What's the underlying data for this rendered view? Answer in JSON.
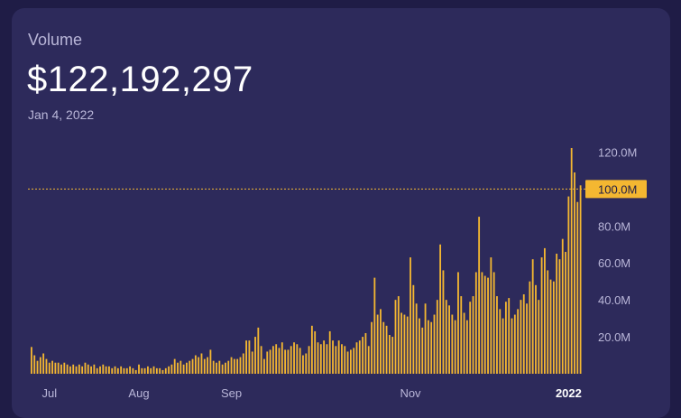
{
  "header": {
    "title": "Volume",
    "value": "$122,192,297",
    "date": "Jan 4, 2022"
  },
  "colors": {
    "background": "#1f1c46",
    "card": "#2d2a5b",
    "bar": "#f4b731",
    "reference_line": "#f4b731",
    "label_muted": "#b9b6d8",
    "label_text": "#ffffff"
  },
  "chart_data": {
    "type": "bar",
    "metric": "Volume (USD)",
    "ylim": [
      0,
      122192297
    ],
    "y_ticks": [
      20000000,
      40000000,
      60000000,
      80000000,
      100000000,
      120000000
    ],
    "y_tick_labels": [
      "20.0M",
      "40.0M",
      "60.0M",
      "80.0M",
      "100.0M",
      "120.0M"
    ],
    "reference_line": {
      "value": 100000000,
      "label": "100.0M"
    },
    "x_tick_labels": [
      {
        "label": "Jul",
        "index": 6,
        "bold": false
      },
      {
        "label": "Aug",
        "index": 36,
        "bold": false
      },
      {
        "label": "Sep",
        "index": 67,
        "bold": false
      },
      {
        "label": "Nov",
        "index": 127,
        "bold": false
      },
      {
        "label": "2022",
        "index": 180,
        "bold": true
      }
    ],
    "grid": false,
    "values_millions": [
      14.5,
      10,
      7,
      9,
      11,
      8,
      6,
      7,
      6,
      6,
      5,
      6,
      5,
      4,
      5,
      4,
      5,
      4,
      6,
      5,
      4,
      5,
      3,
      4,
      5,
      4,
      4,
      3,
      4,
      3,
      4,
      3,
      3,
      4,
      3,
      2,
      5,
      3,
      3,
      4,
      3,
      4,
      3,
      3,
      2,
      3,
      4,
      5,
      8,
      6,
      7,
      5,
      6,
      7,
      8,
      10,
      9,
      11,
      8,
      9,
      13,
      7,
      6,
      7,
      5,
      6,
      7,
      9,
      8,
      8,
      9,
      11,
      18,
      18,
      12,
      20,
      25,
      15,
      8,
      12,
      13,
      15,
      16,
      14,
      17,
      13,
      13,
      15,
      17,
      16,
      14,
      10,
      11,
      15,
      26,
      23,
      17,
      16,
      18,
      16,
      23,
      18,
      15,
      18,
      16,
      15,
      12,
      13,
      14,
      17,
      18,
      20,
      22,
      15,
      28,
      52,
      32,
      35,
      28,
      26,
      21,
      20,
      40,
      42,
      33,
      32,
      31,
      63,
      48,
      38,
      30,
      25,
      38,
      29,
      28,
      32,
      40,
      70,
      56,
      40,
      37,
      32,
      29,
      55,
      42,
      33,
      29,
      39,
      42,
      55,
      85,
      55,
      53,
      52,
      63,
      55,
      42,
      35,
      30,
      39,
      41,
      30,
      32,
      35,
      40,
      43,
      38,
      50,
      62,
      48,
      40,
      63,
      68,
      56,
      51,
      50,
      65,
      62,
      73,
      66,
      96,
      122.2,
      109,
      93,
      102
    ]
  }
}
